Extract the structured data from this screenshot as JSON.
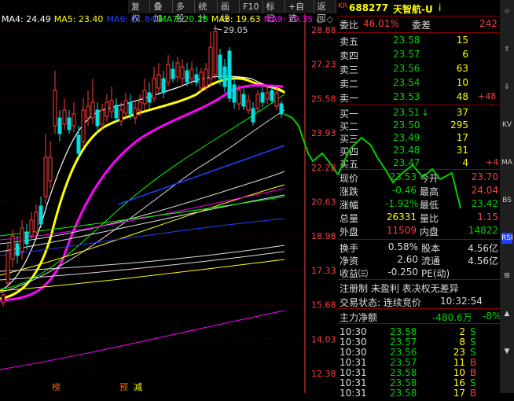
{
  "toolbar": [
    "复权",
    "叠加",
    "多股",
    "统计",
    "画线",
    "F10",
    "标记",
    "+自选",
    "返回"
  ],
  "ma_legend": [
    {
      "label": "MA4: 24.49",
      "color": "#ffffff"
    },
    {
      "label": "MA5: 23.40",
      "color": "#ffff00"
    },
    {
      "label": "MA6: 21.84",
      "color": "#2040ff"
    },
    {
      "label": "MA7: 20.26",
      "color": "#00ff00"
    },
    {
      "label": "MA8: 19.63",
      "color": "#ffff00"
    },
    {
      "label": "MA9: 19.35",
      "color": "#ff00ff"
    }
  ],
  "price_axis": [
    "28.88",
    "27.23",
    "25.58",
    "23.93",
    "22.28",
    "20.63",
    "18.98",
    "17.33",
    "15.68",
    "14.03",
    "12.38"
  ],
  "peak_label": "29.05",
  "bottom_marks": [
    "榜",
    "预",
    "减"
  ],
  "stock": {
    "code_prefix": "KR",
    "code": "688277",
    "name": "天智航-U",
    "flag": "i"
  },
  "weibi": {
    "label": "委比",
    "value": "46.01%",
    "diff_label": "委差",
    "diff": "242"
  },
  "sell": [
    {
      "label": "卖五",
      "price": "23.58",
      "vol": "15"
    },
    {
      "label": "卖四",
      "price": "23.57",
      "vol": "6"
    },
    {
      "label": "卖三",
      "price": "23.56",
      "vol": "63"
    },
    {
      "label": "卖二",
      "price": "23.54",
      "vol": "10"
    },
    {
      "label": "卖一",
      "price": "23.53",
      "vol": "48",
      "chg": "+48"
    }
  ],
  "buy": [
    {
      "label": "买一",
      "price": "23.51",
      "vol": "37",
      "chg": ""
    },
    {
      "label": "买二",
      "price": "23.50",
      "vol": "295",
      "chg": ""
    },
    {
      "label": "买三",
      "price": "23.49",
      "vol": "17",
      "chg": ""
    },
    {
      "label": "买四",
      "price": "23.48",
      "vol": "31",
      "chg": ""
    },
    {
      "label": "买五",
      "price": "23.47",
      "vol": "4",
      "chg": "+4"
    }
  ],
  "quote": [
    {
      "l1": "现价",
      "v1": "23.53",
      "l2": "今开",
      "v2": "23.70"
    },
    {
      "l1": "涨跌",
      "v1": "-0.46",
      "l2": "最高",
      "v2": "24.04"
    },
    {
      "l1": "涨幅",
      "v1": "-1.92%",
      "l2": "最低",
      "v2": "23.42"
    },
    {
      "l1": "总量",
      "v1": "26331",
      "l2": "量比",
      "v2": "1.15"
    },
    {
      "l1": "外盘",
      "v1": "11509",
      "l2": "内盘",
      "v2": "14822"
    }
  ],
  "fund": [
    {
      "l1": "换手",
      "v1": "0.58%",
      "l2": "股本",
      "v2": "4.56亿"
    },
    {
      "l1": "净资",
      "v1": "2.60",
      "l2": "流通",
      "v2": "4.56亿"
    },
    {
      "l1": "收益㈢",
      "v1": "-0.250",
      "l2": "PE(动)",
      "v2": ""
    }
  ],
  "info1": "注册制 未盈利 表决权无差异",
  "info2_label": "交易状态: 连续竞价",
  "info2_time": "10:32:54",
  "mainflow": {
    "label": "主力净额",
    "value": "-480.6万",
    "pct": "-8%"
  },
  "ticks": [
    {
      "time": "10:30",
      "price": "23.58",
      "vol": "2",
      "bs": "S"
    },
    {
      "time": "10:30",
      "price": "23.57",
      "vol": "8",
      "bs": "S"
    },
    {
      "time": "10:30",
      "price": "23.56",
      "vol": "23",
      "bs": "S"
    },
    {
      "time": "10:31",
      "price": "23.57",
      "vol": "11",
      "bs": "B"
    },
    {
      "time": "10:31",
      "price": "23.58",
      "vol": "10",
      "bs": "B"
    },
    {
      "time": "10:31",
      "price": "23.58",
      "vol": "16",
      "bs": "S"
    },
    {
      "time": "10:31",
      "price": "23.58",
      "vol": "17",
      "bs": "B"
    }
  ],
  "side_icons": [
    "☆",
    "⇧",
    "⇩",
    "KV",
    "MA",
    "BS",
    "RSI",
    "⊞",
    "▲",
    "▼"
  ],
  "colors": {
    "up": "#ff3c3c",
    "down": "#00e0e0",
    "green": "#00d000",
    "yellow": "#ffff00",
    "axis": "#ff3c3c"
  }
}
